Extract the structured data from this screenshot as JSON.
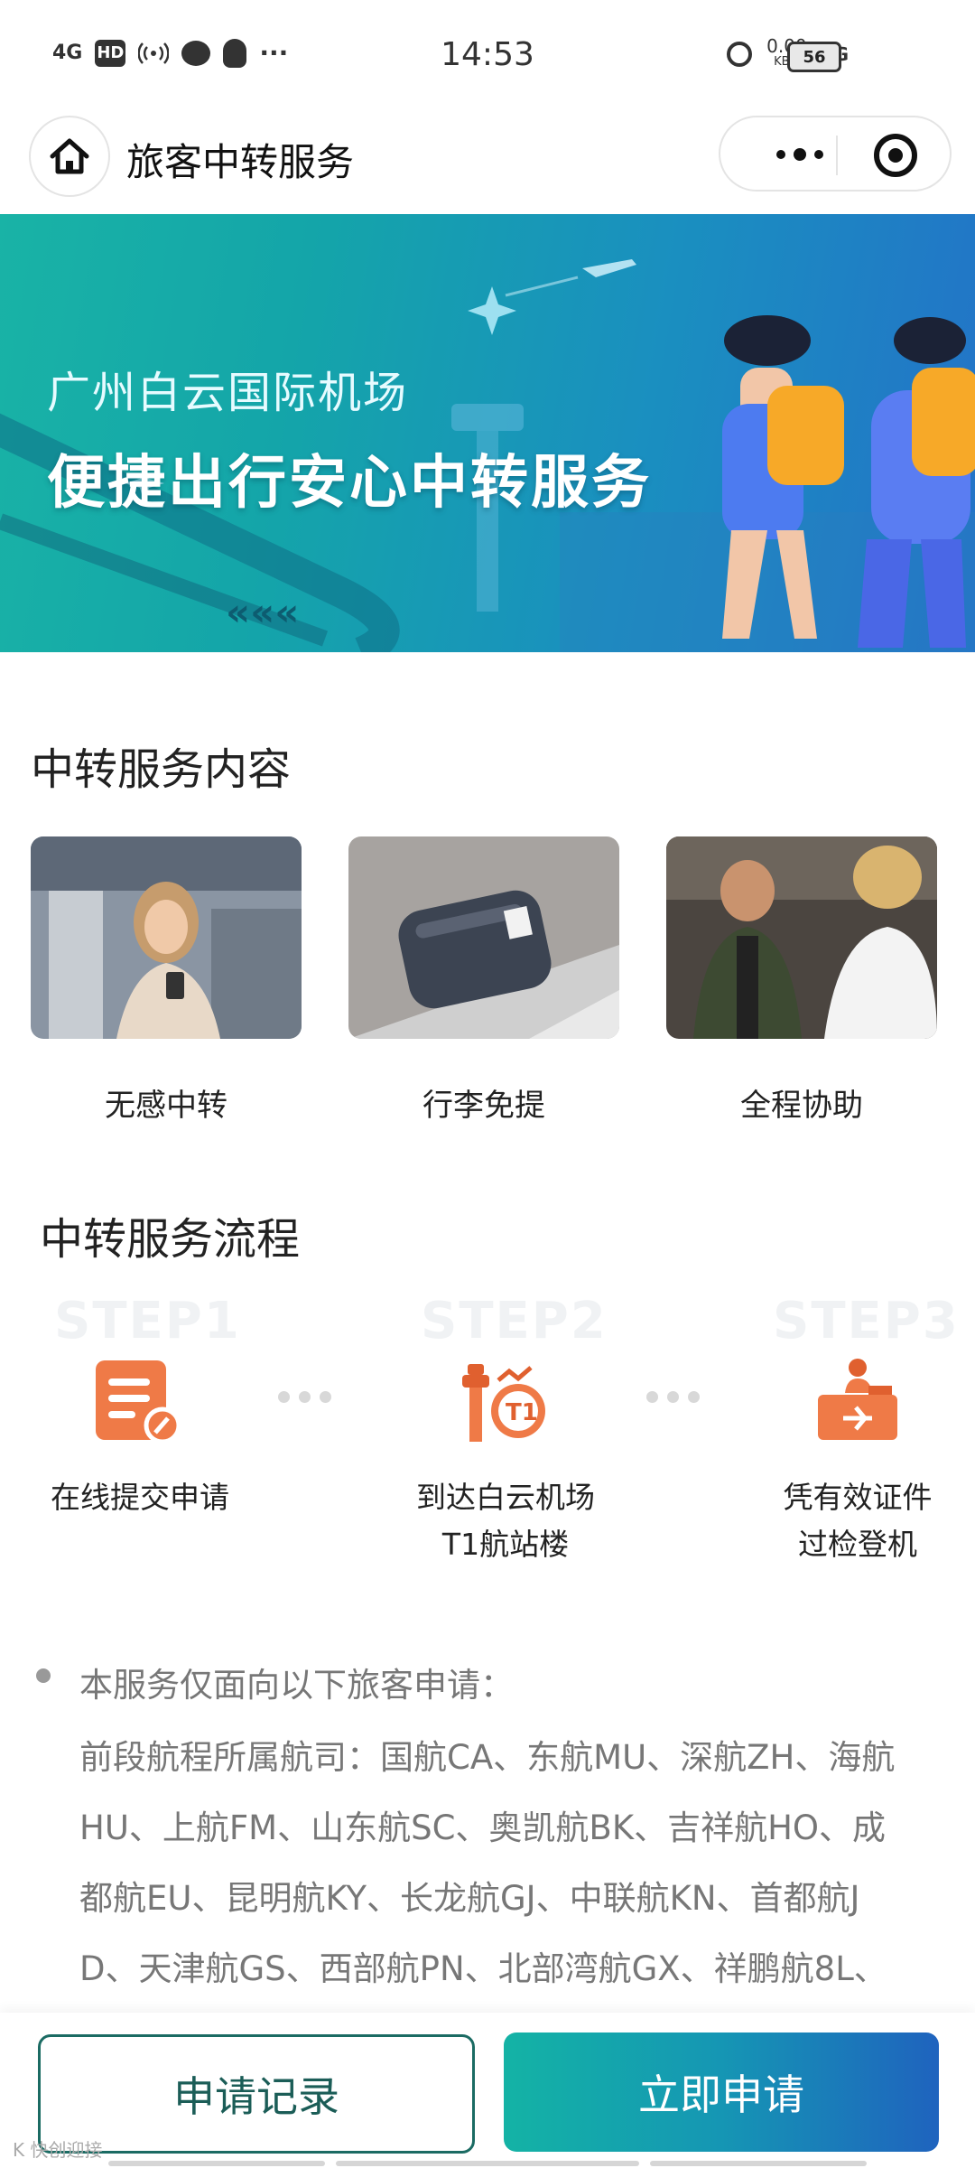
{
  "status_bar": {
    "time": "14:53",
    "signal_left": "4G",
    "hd": "HD",
    "net_speed": "0.00",
    "net_unit": "KB/s",
    "signal_right": "4G",
    "battery": "56"
  },
  "nav": {
    "title": "旅客中转服务"
  },
  "banner": {
    "subtitle": "广州白云国际机场",
    "headline": "便捷出行安心中转服务"
  },
  "services": {
    "title": "中转服务内容",
    "items": [
      {
        "label": "无感中转"
      },
      {
        "label": "行李免提"
      },
      {
        "label": "全程协助"
      }
    ]
  },
  "process": {
    "title": "中转服务流程",
    "steps": [
      {
        "bg": "STEP1",
        "line1": "在线提交申请",
        "line2": ""
      },
      {
        "bg": "STEP2",
        "line1": "到达白云机场",
        "line2": "T1航站楼"
      },
      {
        "bg": "STEP3",
        "line1": "凭有效证件",
        "line2": "过检登机"
      }
    ]
  },
  "notes": {
    "heading": "本服务仅面向以下旅客申请：",
    "lines": [
      "前段航程所属航司：国航CA、东航MU、深航ZH、海航",
      "HU、上航FM、山东航SC、奥凯航BK、吉祥航HO、成",
      "都航EU、昆明航KY、长龙航GJ、中联航KN、首都航J",
      "D、天津航GS、西部航PN、北部湾航GX、祥鹏航8L、"
    ]
  },
  "actions": {
    "records": "申请记录",
    "apply": "立即申请"
  },
  "watermark": "K 快创迎接"
}
